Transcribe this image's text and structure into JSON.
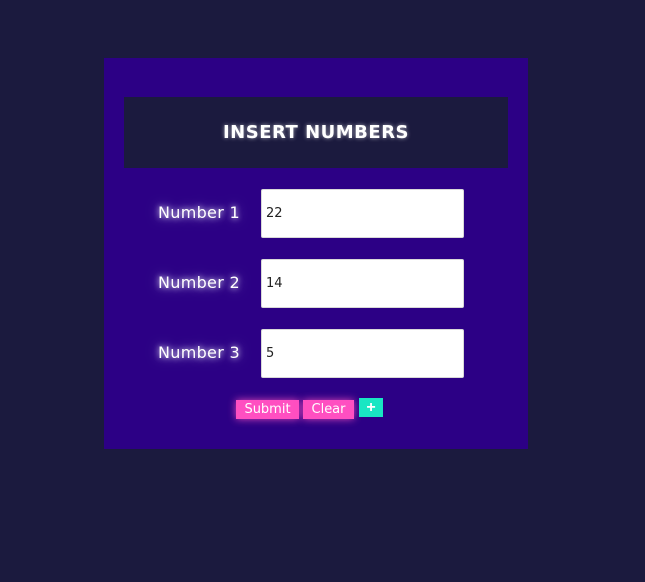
{
  "header": {
    "title": "INSERT NUMBERS"
  },
  "fields": [
    {
      "label": "Number 1",
      "value": "22"
    },
    {
      "label": "Number 2",
      "value": "14"
    },
    {
      "label": "Number 3",
      "value": "5"
    }
  ],
  "buttons": {
    "submit_label": "Submit",
    "clear_label": "Clear",
    "add_label": "+"
  },
  "colors": {
    "page_background": "#1b1a3e",
    "panel_background": "#2c0085",
    "header_background": "#1b1a3e",
    "button_pink": "#ff4fc1",
    "button_teal": "#19e6c3"
  }
}
